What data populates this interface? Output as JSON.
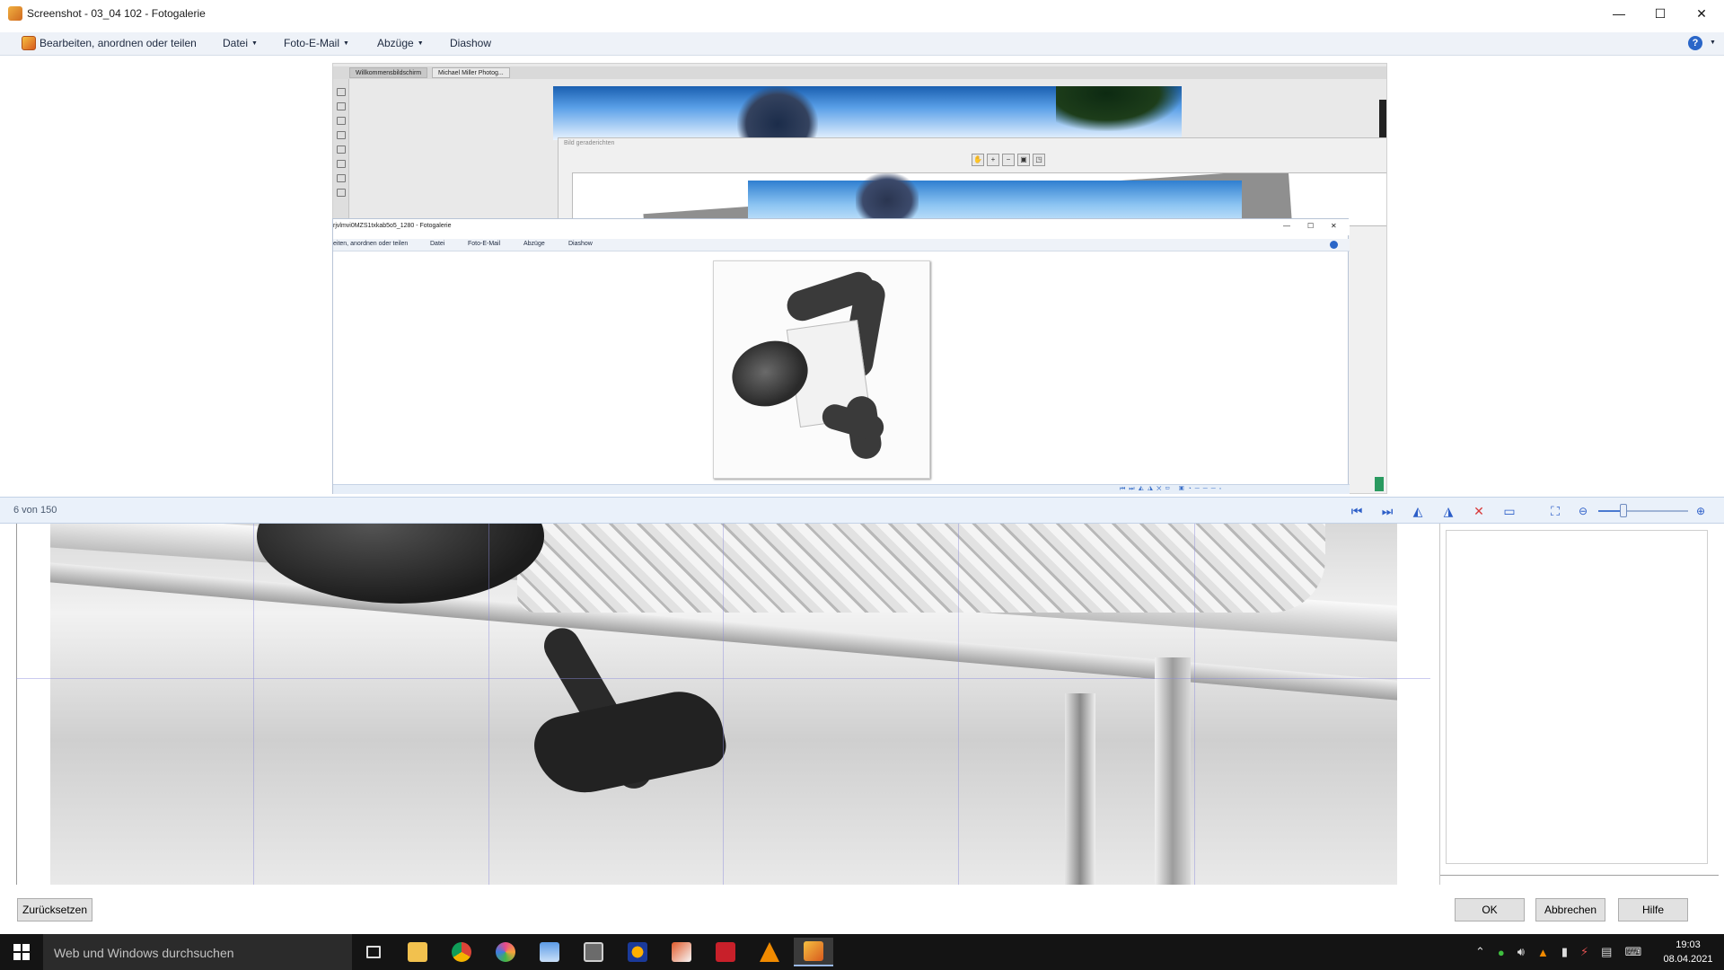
{
  "window": {
    "title": "Screenshot - 03_04 102 - Fotogalerie",
    "controls": {
      "minimize": "—",
      "maximize": "☐",
      "close": "✕"
    }
  },
  "menubar": {
    "edit": "Bearbeiten, anordnen oder teilen",
    "file": "Datei",
    "photo_email": "Foto-E-Mail",
    "prints": "Abzüge",
    "slideshow": "Diashow",
    "help_glyph": "?"
  },
  "nested_editor": {
    "tabs": [
      "Willkommensbildschirm",
      "Michael Miller Photog..."
    ],
    "dialog_title": "Bild geraderichten"
  },
  "nested_gallery": {
    "title": "rjvlmvi0MZS1txkab5o5_1280 - Fotogalerie",
    "menu": {
      "edit": "eiten, anordnen oder teilen",
      "file": "Datei",
      "photo_email": "Foto-E-Mail",
      "prints": "Abzüge",
      "slideshow": "Diashow"
    },
    "controls": {
      "minimize": "—",
      "maximize": "☐",
      "close": "✕"
    }
  },
  "statusbar": {
    "position": "6 von 150",
    "zoom_level": 0.28
  },
  "dialog_buttons": {
    "reset": "Zurücksetzen",
    "ok": "OK",
    "cancel": "Abbrechen",
    "help": "Hilfe"
  },
  "taskbar": {
    "search_placeholder": "Web und Windows durchsuchen",
    "time": "19:03",
    "date": "08.04.2021"
  },
  "colors": {
    "accent": "#2c5ec8",
    "menubar_bg": "#eef2f8",
    "statusbar_bg": "#eaf1fa",
    "taskbar_bg": "#141414",
    "delete_red": "#d83a3a"
  }
}
